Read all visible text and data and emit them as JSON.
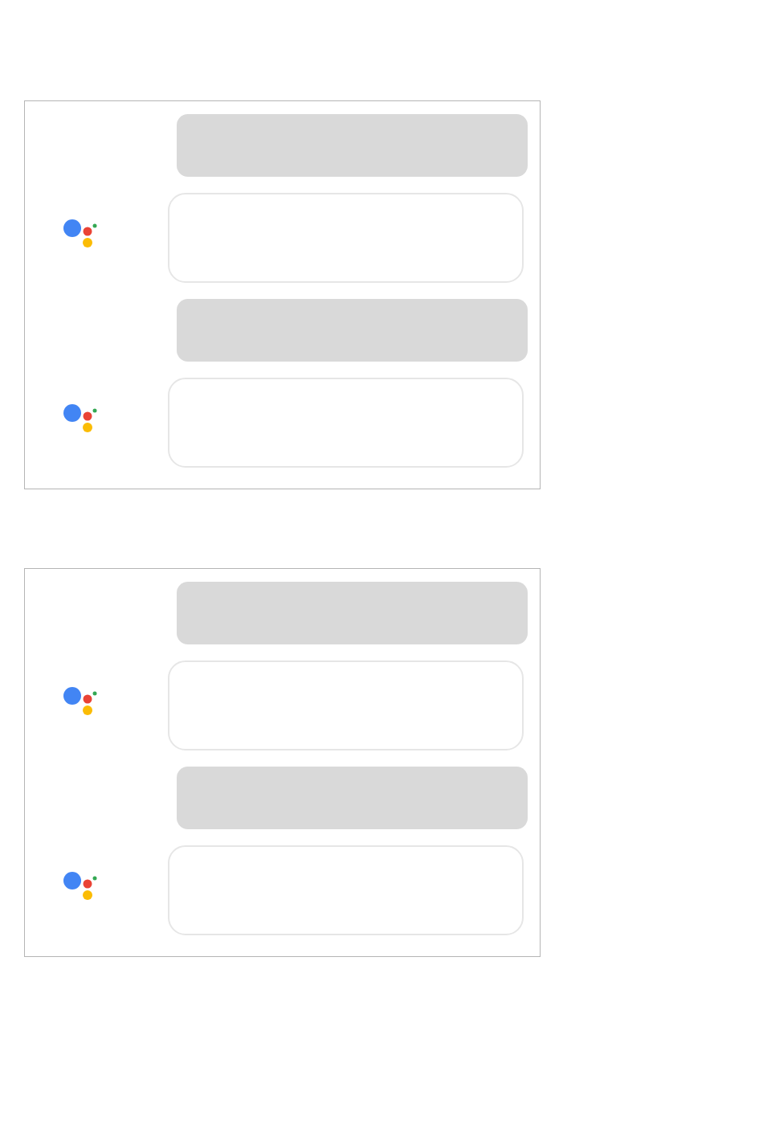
{
  "panels": [
    {
      "messages": [
        {
          "kind": "user"
        },
        {
          "kind": "assistant"
        },
        {
          "kind": "user"
        },
        {
          "kind": "assistant"
        }
      ]
    },
    {
      "messages": [
        {
          "kind": "user"
        },
        {
          "kind": "assistant"
        },
        {
          "kind": "user"
        },
        {
          "kind": "assistant"
        }
      ]
    }
  ]
}
